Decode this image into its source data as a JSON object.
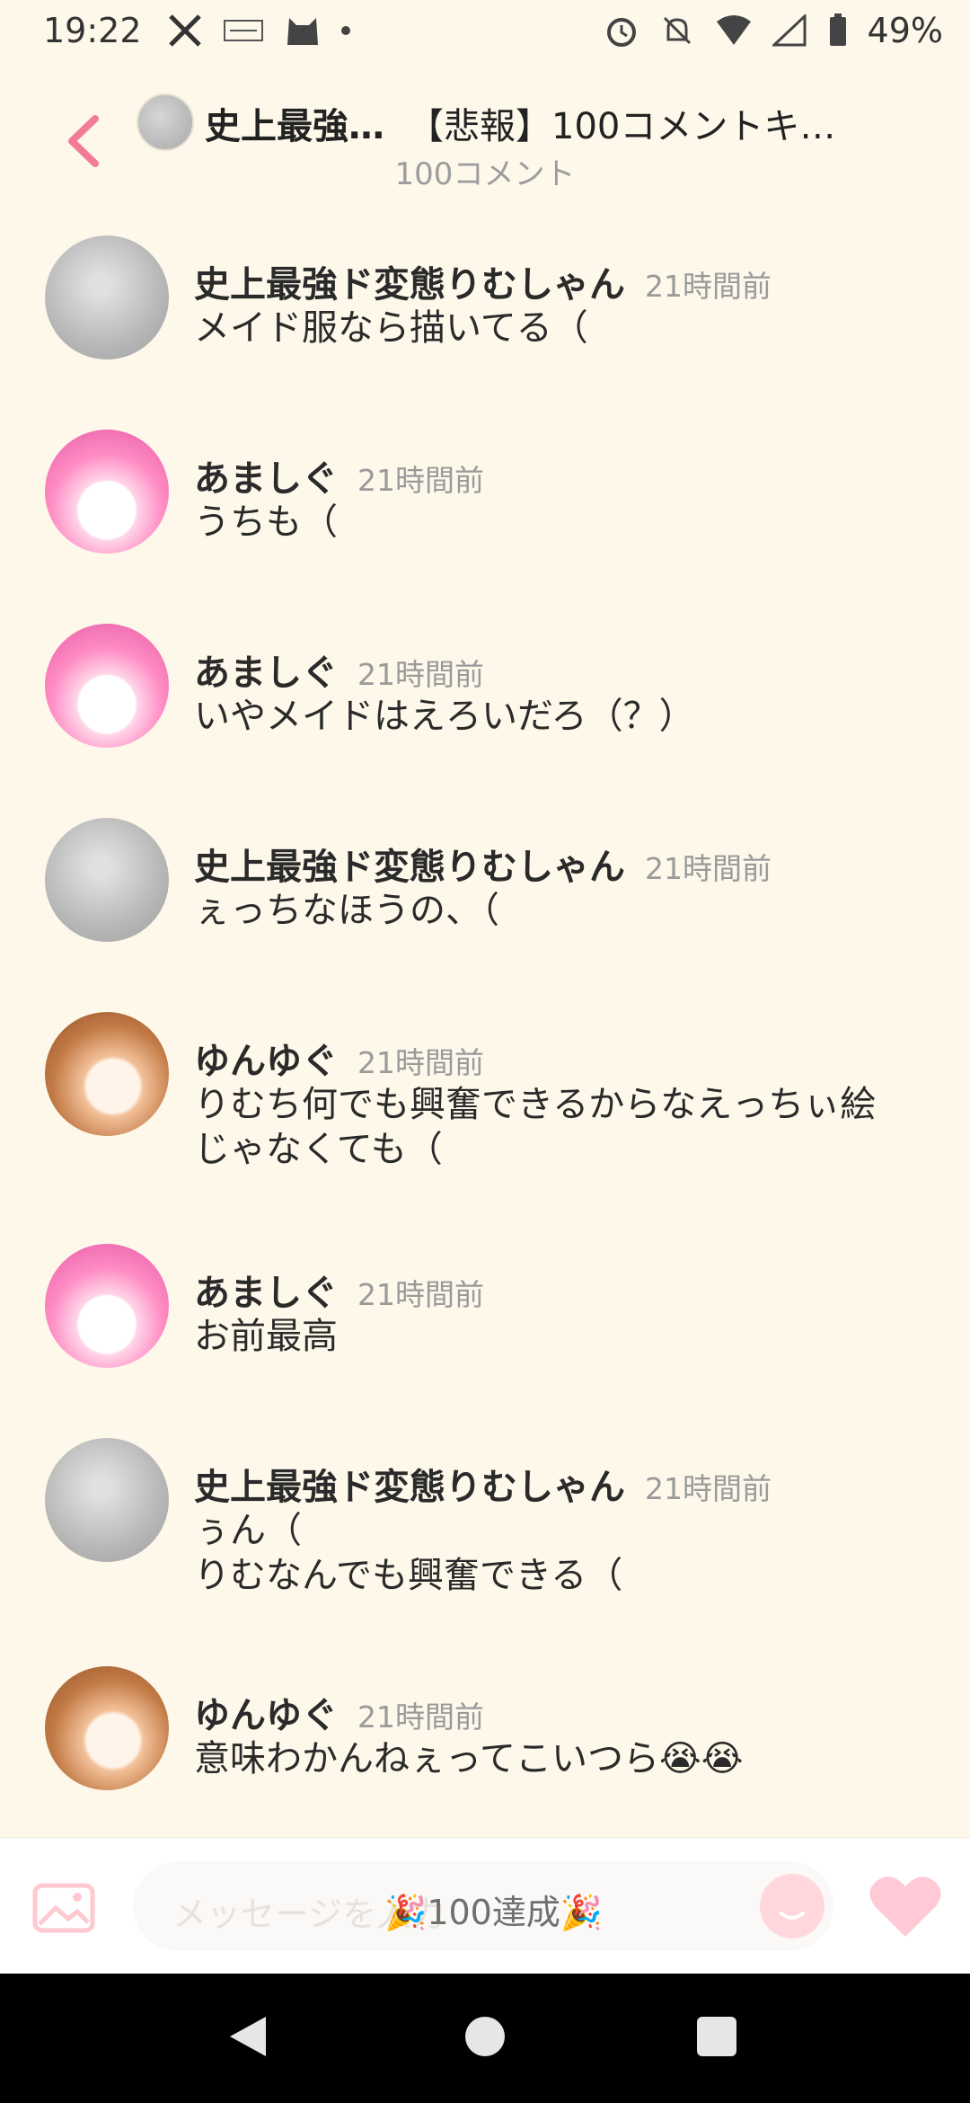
{
  "status_bar": {
    "time": "19:22",
    "battery": "49%",
    "left_icons": [
      "x-logo-icon",
      "app-badge-icon",
      "cat-icon",
      "dot-icon"
    ],
    "right_icons": [
      "alarm-icon",
      "bell-off-icon",
      "wifi-icon",
      "signal-icon",
      "battery-icon"
    ]
  },
  "header": {
    "room_name": "史上最強…",
    "thread_title": "【悲報】100コメントキ…",
    "comment_count": "100コメント"
  },
  "comments": [
    {
      "name": "史上最強ド変態りむしゃん",
      "time": "21時間前",
      "text": "メイド服なら描いてる（",
      "avatar": "gray"
    },
    {
      "name": "あましぐ",
      "time": "21時間前",
      "text": "うちも（",
      "avatar": "pink"
    },
    {
      "name": "あましぐ",
      "time": "21時間前",
      "text": "いやメイドはえろいだろ（？）",
      "avatar": "pink"
    },
    {
      "name": "史上最強ド変態りむしゃん",
      "time": "21時間前",
      "text": "ぇっちなほうの、（",
      "avatar": "gray"
    },
    {
      "name": "ゆんゆぐ",
      "time": "21時間前",
      "text": "りむち何でも興奮できるからなえっちぃ絵\nじゃなくても（",
      "avatar": "brown"
    },
    {
      "name": "あましぐ",
      "time": "21時間前",
      "text": "お前最高",
      "avatar": "pink"
    },
    {
      "name": "史上最強ド変態りむしゃん",
      "time": "21時間前",
      "text": "ぅん（\nりむなんでも興奮できる（",
      "avatar": "gray"
    },
    {
      "name": "ゆんゆぐ",
      "time": "21時間前",
      "text": "意味わかんねぇってこいつら😭😭",
      "avatar": "brown"
    }
  ],
  "input": {
    "placeholder": "メッセージを入力",
    "overlay": "🎉100達成🎉"
  },
  "colors": {
    "background": "#fdf8ea",
    "accent_pink": "#f27c95",
    "heart_pink": "#ffc9d6"
  }
}
